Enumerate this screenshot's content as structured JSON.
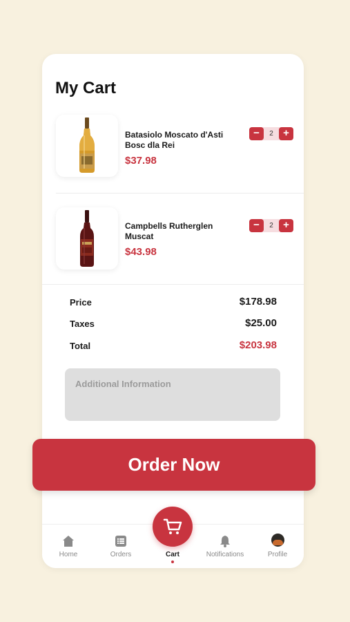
{
  "cart": {
    "title": "My Cart",
    "items": [
      {
        "name": "Batasiolo Moscato d'Asti Bosc dla Rei",
        "price": "$37.98",
        "quantity": "2",
        "image_icon": "wine-bottle-white-icon"
      },
      {
        "name": "Campbells Rutherglen Muscat",
        "price": "$43.98",
        "quantity": "2",
        "image_icon": "wine-bottle-red-icon"
      }
    ],
    "stepper": {
      "minus_label": "−",
      "plus_label": "+"
    }
  },
  "summary": {
    "price_label": "Price",
    "price_value": "$178.98",
    "taxes_label": "Taxes",
    "taxes_value": "$25.00",
    "total_label": "Total",
    "total_value": "$203.98"
  },
  "additional_info": {
    "placeholder": "Additional Information",
    "value": ""
  },
  "order_button": {
    "label": "Order Now"
  },
  "tabbar": {
    "tabs": [
      {
        "label": "Home",
        "icon": "home-icon"
      },
      {
        "label": "Orders",
        "icon": "orders-list-icon"
      },
      {
        "label": "Cart",
        "icon": "cart-icon",
        "active": true
      },
      {
        "label": "Notifications",
        "icon": "bell-icon"
      },
      {
        "label": "Profile",
        "icon": "avatar"
      }
    ]
  },
  "colors": {
    "accent": "#c8343f",
    "background": "#f8f1df",
    "card": "#ffffff",
    "input": "#dedede"
  }
}
